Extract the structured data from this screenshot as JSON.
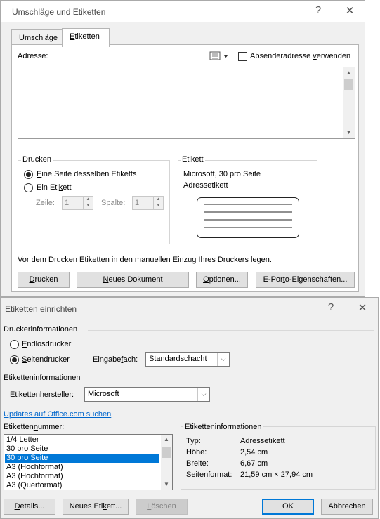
{
  "dialog1": {
    "title": "Umschläge und Etiketten",
    "help_icon": "question-mark-icon",
    "close_icon": "close-icon",
    "tabs": [
      {
        "label_underlined": "U",
        "label_rest": "mschläge"
      },
      {
        "label_underlined": "E",
        "label_rest": "tiketten"
      }
    ],
    "address_label": "Adresse:",
    "sender_checkbox": {
      "before": "Absenderadresse ",
      "underlined": "v",
      "after": "erwenden",
      "checked": false
    },
    "address_value": "",
    "print_group": {
      "title": "Drucken",
      "option_full_page": {
        "underlined": "E",
        "rest": "ine Seite desselben Etiketts",
        "checked": true
      },
      "option_single": {
        "before": "Ein Eti",
        "underlined": "k",
        "after": "ett",
        "checked": false
      },
      "row_label": "Zeile:",
      "row_value": "1",
      "column_label": "Spalte:",
      "column_value": "1"
    },
    "label_group": {
      "title": "Etikett",
      "line1": "Microsoft, 30 pro Seite",
      "line2": "Adressetikett"
    },
    "instruction": "Vor dem Drucken Etiketten in den manuellen Einzug Ihres Druckers legen.",
    "buttons": {
      "print": {
        "underlined": "D",
        "rest": "rucken"
      },
      "new_document": {
        "before": "",
        "underlined": "N",
        "after": "eues Dokument"
      },
      "options": {
        "underlined": "O",
        "rest": "ptionen..."
      },
      "eporto": {
        "before": "E-Por",
        "underlined": "t",
        "after": "o-Eigenschaften..."
      }
    }
  },
  "dialog2": {
    "title": "Etiketten einrichten",
    "help_icon": "question-mark-icon",
    "close_icon": "close-icon",
    "printer_info_header": "Druckerinformationen",
    "continuous": {
      "underlined": "E",
      "rest": "ndlosdrucker",
      "checked": false
    },
    "page_printer": {
      "underlined": "S",
      "rest": "eitendrucker",
      "checked": true
    },
    "tray_label": {
      "before": "Eingabe",
      "underlined": "f",
      "after": "ach:"
    },
    "tray_value": "Standardschacht",
    "label_info_header": "Etiketteninformationen",
    "vendor_label": {
      "before": "E",
      "underlined": "t",
      "after": "ikettenhersteller:"
    },
    "vendor_value": "Microsoft",
    "updates_link": "Updates auf Office.com suchen",
    "number_label": {
      "before": "Etiketten",
      "underlined": "n",
      "after": "ummer:"
    },
    "list_items": [
      "1/4 Letter",
      "30 pro Seite",
      "30 pro Seite",
      "A3 (Hochformat)",
      "A3 (Hochformat)",
      "A3 (Querformat)"
    ],
    "selected_index": 2,
    "info_box": {
      "title": "Etiketteninformationen",
      "rows": [
        {
          "key": "Typ:",
          "value": "Adressetikett"
        },
        {
          "key": "Höhe:",
          "value": "2,54 cm"
        },
        {
          "key": "Breite:",
          "value": "6,67 cm"
        },
        {
          "key": "Seitenformat:",
          "value": "21,59 cm × 27,94 cm"
        }
      ]
    },
    "buttons": {
      "details": {
        "underlined": "D",
        "rest": "etails..."
      },
      "new_label": {
        "before": "Neues Eti",
        "underlined": "k",
        "after": "ett..."
      },
      "delete": {
        "underlined": "L",
        "rest": "öschen",
        "enabled": false
      },
      "ok": "OK",
      "cancel": "Abbrechen"
    }
  },
  "colors": {
    "accent": "#0078d7",
    "link": "#0066cc",
    "dialog_bg": "#f0f0f0"
  }
}
